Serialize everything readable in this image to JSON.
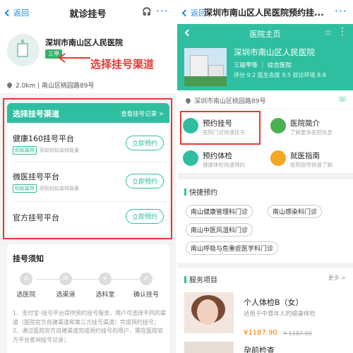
{
  "left": {
    "back_label": "返回",
    "title": "就诊挂号",
    "hospital_name": "深圳市南山区人民医院",
    "hospital_badge": "三甲",
    "annotation": "选择挂号渠道",
    "address": "2.0km | 南山区桃园路89号",
    "channel_header": "选择挂号渠道",
    "channel_records": "查看挂号记录 >",
    "channels": [
      {
        "name": "健康160挂号平台",
        "sub_logo": "蚂蚁森林",
        "sub": "获取蚂蚁森林能量",
        "button": "立即预约"
      },
      {
        "name": "微医挂号平台",
        "sub_logo": "蚂蚁森林",
        "sub": "获取蚂蚁森林能量",
        "button": "立即预约"
      },
      {
        "name": "官方挂号平台",
        "sub_logo": "",
        "sub": "",
        "button": "立即预约"
      }
    ],
    "notice_title": "挂号须知",
    "steps": [
      "选医院",
      "选渠道",
      "选科室",
      "确认挂号"
    ],
    "notice_text": "1、支付宝–挂号平台提供预约挂号服务，用户可选择不同的渠道（医院官方自建渠道和第三方挂号渠道）完成预约挂号；2、通过医院官方自建渠道完成预约挂号的用户，需在医院官方平台查询挂号记录；"
  },
  "right": {
    "back_label": "返回",
    "title": "深圳市南山区人民医院预约挂...",
    "bar_title": "医院主页",
    "hospital_name": "深圳市南山区人民医院",
    "hospital_level": "三级甲等 ｜ 综合医院",
    "hospital_scores": "评分 9.2  医生态度 9.5  就诊环境 8.8",
    "address": "深圳市南山区桃园路89号",
    "services": [
      {
        "title": "预约挂号",
        "desc": "医院门诊快速挂号",
        "color": "#2fbfa0"
      },
      {
        "title": "医院简介",
        "desc": "了解更多医院信息",
        "color": "#4caf50"
      },
      {
        "title": "预约体检",
        "desc": "健康体检快速预约",
        "color": "#2fbfa0"
      },
      {
        "title": "就医指南",
        "desc": "医院指导快速了解",
        "color": "#f5a623"
      }
    ],
    "fast_title": "快捷预约",
    "departments": [
      "南山健康管理科门诊",
      "南山感染科门诊",
      "南山中医风湿科门诊",
      "南山呼吸与危重症医学科门诊"
    ],
    "svc_title": "服务项目",
    "svc_more": "更多 >",
    "product": {
      "name": "个人体检B（女）",
      "desc": "适用于中青年人的健康体检",
      "price": "¥1187.90",
      "old_price": "¥ 1187.90"
    },
    "product2_name": "孕前检查"
  }
}
